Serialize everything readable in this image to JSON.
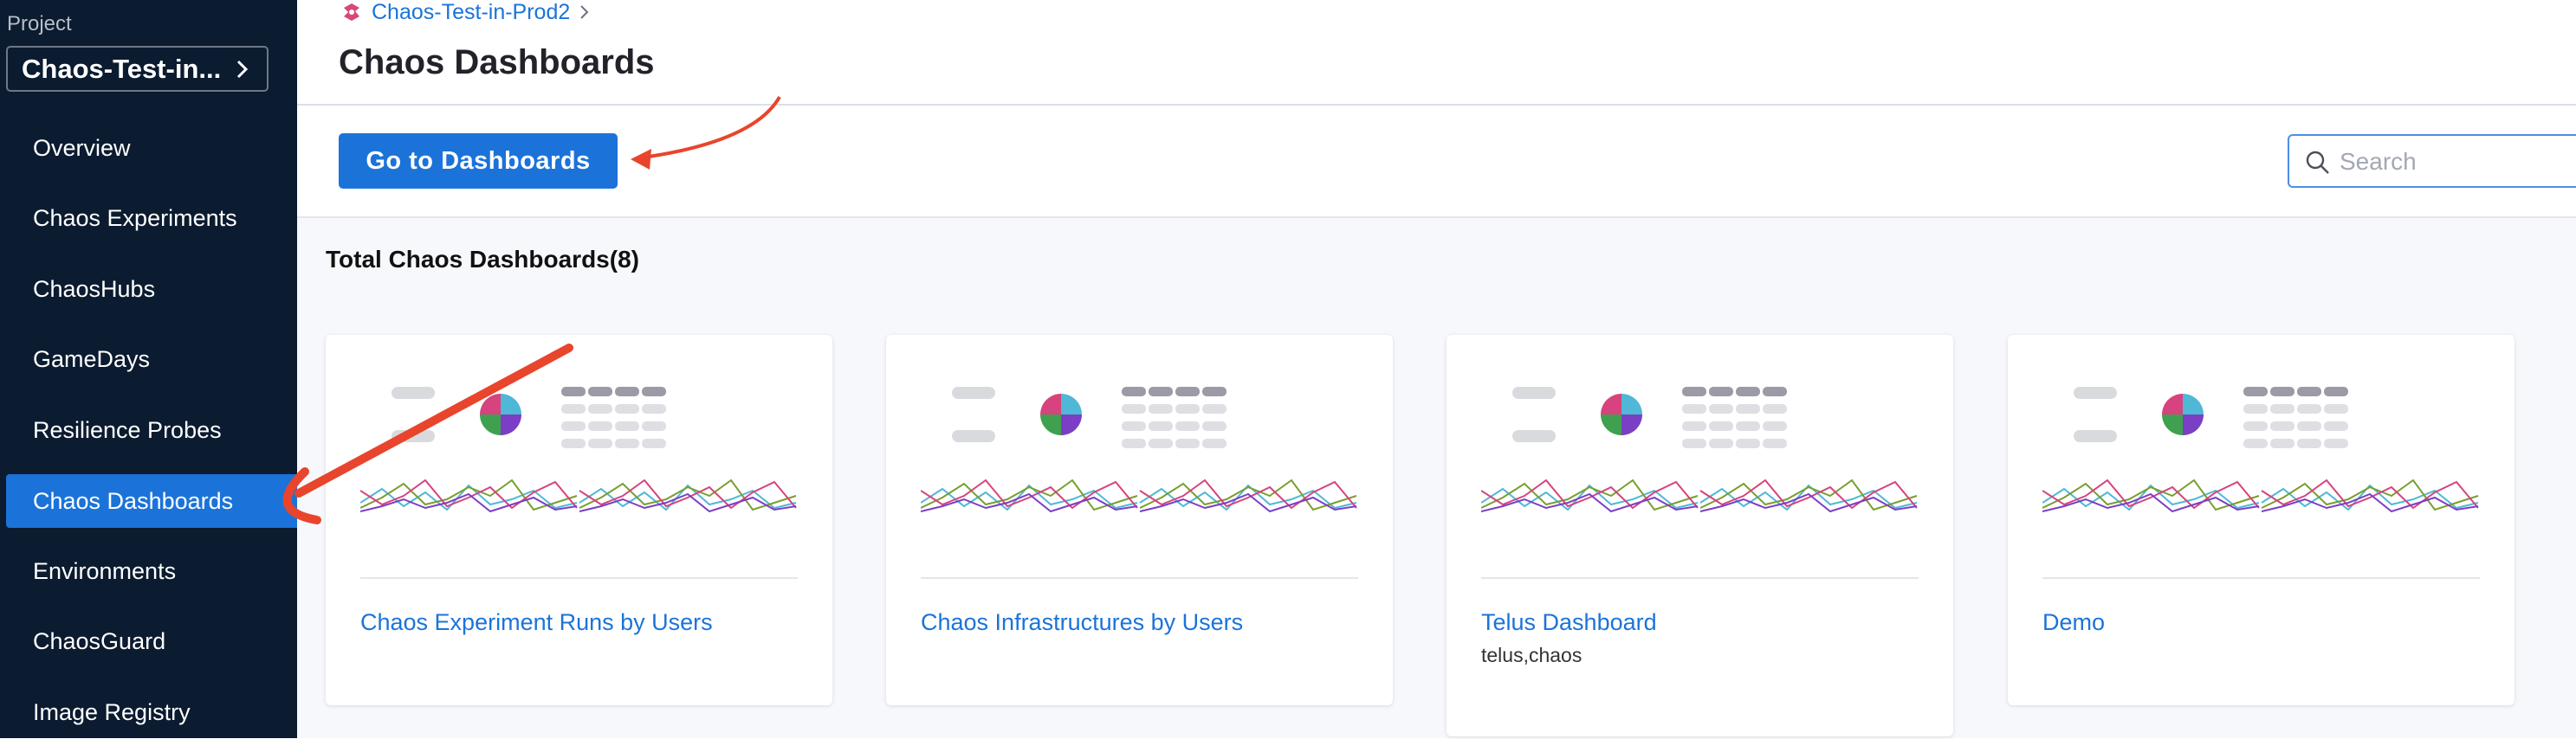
{
  "sidebar": {
    "project_label": "Project",
    "project_name": "Chaos-Test-in...",
    "items": [
      {
        "label": "Overview"
      },
      {
        "label": "Chaos Experiments"
      },
      {
        "label": "ChaosHubs"
      },
      {
        "label": "GameDays"
      },
      {
        "label": "Resilience Probes"
      },
      {
        "label": "Chaos Dashboards",
        "active": true
      },
      {
        "label": "Environments"
      },
      {
        "label": "ChaosGuard"
      },
      {
        "label": "Image Registry"
      }
    ]
  },
  "header": {
    "breadcrumb": "Chaos-Test-in-Prod2",
    "title": "Chaos Dashboards"
  },
  "toolbar": {
    "goto_label": "Go to Dashboards",
    "search_placeholder": "Search",
    "search_value": ""
  },
  "content": {
    "total_label": "Total Chaos Dashboards(8)",
    "cards": [
      {
        "name": "Chaos Experiment Runs by Users",
        "tags": ""
      },
      {
        "name": "Chaos Infrastructures by Users",
        "tags": ""
      },
      {
        "name": "Telus Dashboard",
        "tags": "telus,chaos"
      },
      {
        "name": "Demo",
        "tags": ""
      }
    ]
  },
  "colors": {
    "sidebar_bg": "#0b1b30",
    "accent": "#1b73d9",
    "annotation_arrow": "#e8452c"
  },
  "icons": {
    "breadcrumb": "chaos-logo-icon",
    "project_select": "chevron-right-icon",
    "search": "search-icon"
  }
}
